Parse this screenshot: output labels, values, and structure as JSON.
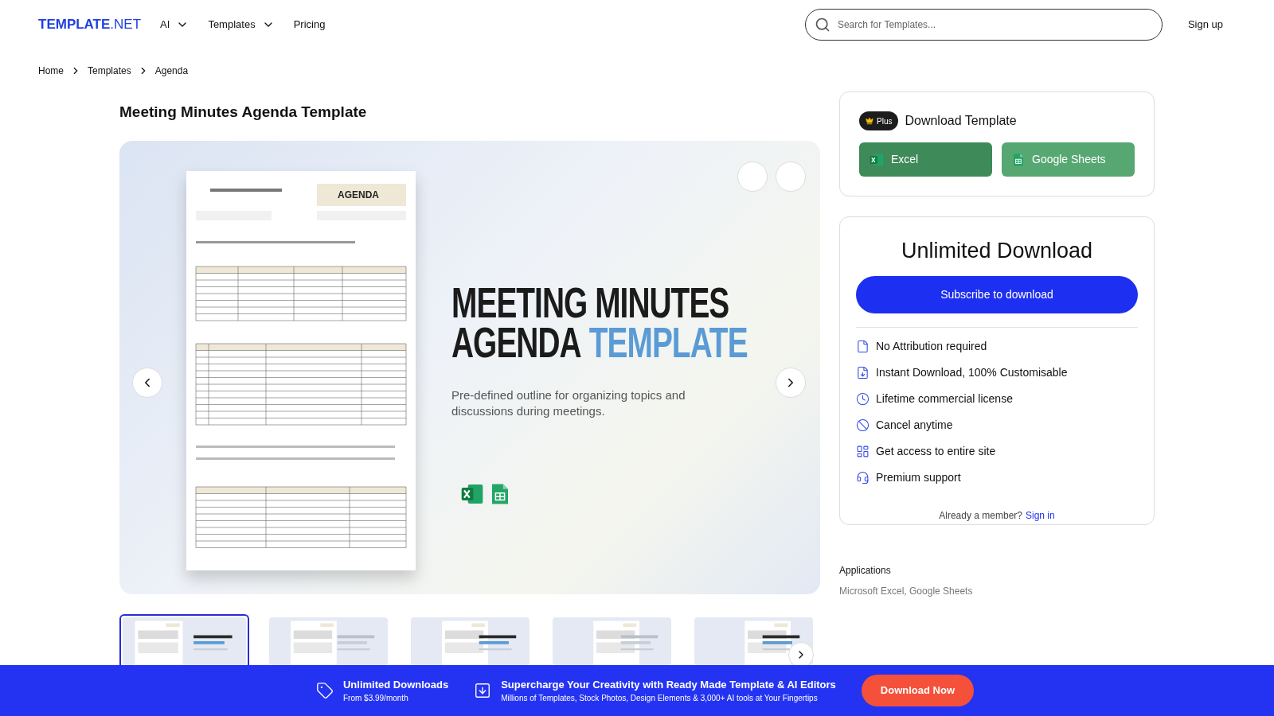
{
  "header": {
    "logo": "**TEMPLATE**.NET",
    "nav": [
      {
        "label": "AI",
        "dropdown": true
      },
      {
        "label": "Templates",
        "dropdown": true
      },
      {
        "label": "Pricing",
        "dropdown": false
      }
    ],
    "search": {
      "placeholder": "Search for Templates..."
    },
    "signup": "Sign up"
  },
  "breadcrumb": [
    "Home",
    "Templates",
    "Agenda"
  ],
  "title": "Meeting Minutes Agenda Template",
  "preview": {
    "heading_line1": "MEETING MINUTES",
    "heading_dark": "AGENDA",
    "heading_accent": "TEMPLATE",
    "description": "Pre-defined outline for organizing topics and discussions during meetings.",
    "document": {
      "kind": "picture",
      "badge": "AGENDA"
    }
  },
  "thumbnails": [
    {
      "kind": "picture",
      "selected": true
    },
    {
      "kind": "picture",
      "selected": false
    },
    {
      "kind": "picture",
      "selected": false
    },
    {
      "kind": "picture",
      "selected": false
    },
    {
      "kind": "picture",
      "selected": false
    }
  ],
  "download_card": {
    "badge": "Plus",
    "title": "Download Template",
    "buttons": [
      {
        "label": "Excel",
        "kind": "excel"
      },
      {
        "label": "Google Sheets",
        "kind": "sheets"
      }
    ]
  },
  "unlimited": {
    "title": "Unlimited Download",
    "button": "Subscribe to download",
    "features": [
      "No Attribution required",
      "Instant Download, 100% Customisable",
      "Lifetime commercial license",
      "Cancel anytime",
      "Get access to entire site",
      "Premium support"
    ],
    "member_text": "Already a member?",
    "member_link": "Sign in"
  },
  "applications": {
    "label": "Applications",
    "value": "Microsoft Excel, Google Sheets"
  },
  "banner": {
    "items": [
      {
        "kind": "tag",
        "title": "Unlimited Downloads",
        "subtitle": "From $3.99/month"
      },
      {
        "kind": "download",
        "title": "Supercharge Your Creativity with Ready Made Template & AI Editors",
        "subtitle": "Millions of Templates, Stock Photos, Design Elements & 3,000+ AI tools at Your Fingertips"
      }
    ],
    "button": "Download Now"
  }
}
